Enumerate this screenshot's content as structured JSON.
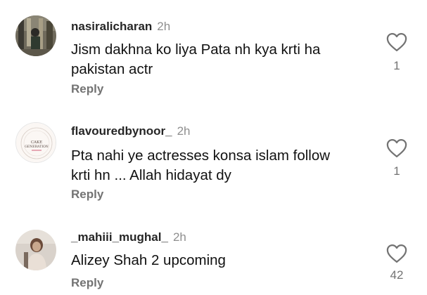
{
  "comments": [
    {
      "username": "nasiralicharan",
      "time": "2h",
      "text": "Jism dakhna ko liya Pata nh kya krti ha pakistan actr",
      "reply_label": "Reply",
      "likes": "1",
      "avatar_icon": "user-photo-avatar"
    },
    {
      "username": "flavouredbynoor_",
      "time": "2h",
      "text": "Pta nahi ye actresses konsa islam follow krti hn ... Allah hidayat dy",
      "reply_label": "Reply",
      "likes": "1",
      "avatar_icon": "cake-generation-logo-avatar",
      "avatar_logo_text": "CAKE GENERATION"
    },
    {
      "username": "_mahiii_mughal_",
      "time": "2h",
      "text": "Alizey Shah 2 upcoming",
      "reply_label": "Reply",
      "likes": "42",
      "avatar_icon": "user-photo-avatar"
    }
  ],
  "colors": {
    "username": "#262626",
    "secondary": "#737373",
    "text": "#111111",
    "background": "#ffffff"
  }
}
